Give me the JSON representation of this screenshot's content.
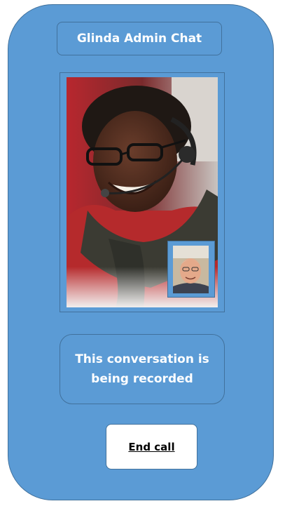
{
  "app": {
    "title": "Glinda Admin Chat"
  },
  "call": {
    "remote_video": "agent-video-feed",
    "self_video": "self-preview-feed",
    "recording_notice": "This conversation is being recorded",
    "end_call_label": "End call"
  },
  "colors": {
    "phone_background": "#5b9bd5",
    "border": "#41719c",
    "text": "#ffffff",
    "button_background": "#ffffff",
    "button_text": "#000000"
  }
}
